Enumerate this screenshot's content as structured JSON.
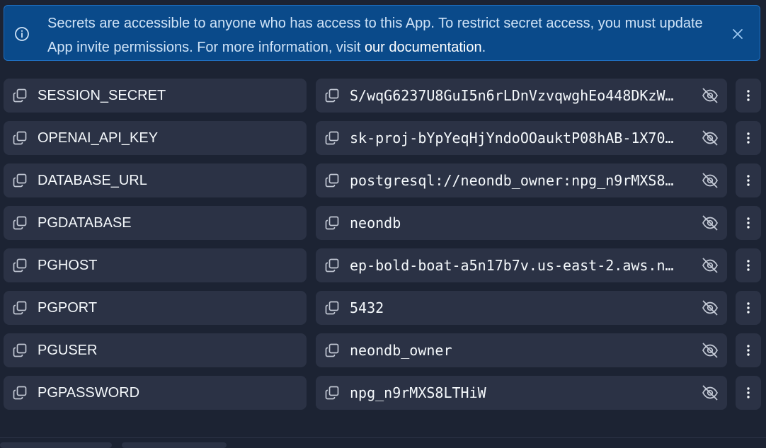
{
  "banner": {
    "icon": "info-icon",
    "text_before_link": "Secrets are accessible to anyone who has access to this App. To restrict secret access, you must update App invite permissions. For more information, visit ",
    "link_text": "our documentation",
    "text_after_link": ".",
    "close_icon": "close-icon"
  },
  "secrets": [
    {
      "key": "SESSION_SECRET",
      "value": "S/wqG6237U8GuI5n6rLDnVzvqwghEo448DKzW…"
    },
    {
      "key": "OPENAI_API_KEY",
      "value": "sk-proj-bYpYeqHjYndoOOauktP08hAB-1X70…"
    },
    {
      "key": "DATABASE_URL",
      "value": "postgresql://neondb_owner:npg_n9rMXS8…"
    },
    {
      "key": "PGDATABASE",
      "value": "neondb"
    },
    {
      "key": "PGHOST",
      "value": "ep-bold-boat-a5n17b7v.us-east-2.aws.n…"
    },
    {
      "key": "PGPORT",
      "value": "5432"
    },
    {
      "key": "PGUSER",
      "value": "neondb_owner"
    },
    {
      "key": "PGPASSWORD",
      "value": "npg_n9rMXS8LTHiW"
    }
  ],
  "icons": {
    "copy": "copy-icon",
    "visibility": "eye-off-icon",
    "more": "more-vertical-icon"
  },
  "colors": {
    "background": "#1c2333",
    "surface": "#2b3245",
    "banner_bg": "#0a4a8a",
    "banner_border": "#1f6fc0",
    "text": "#f5f9fc",
    "banner_text": "#cfe3f7",
    "icon": "#c2c8d4"
  }
}
